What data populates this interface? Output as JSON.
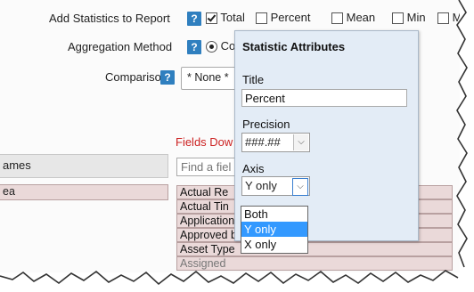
{
  "stats": {
    "label": "Add Statistics to Report",
    "options": [
      {
        "label": "Total",
        "checked": true
      },
      {
        "label": "Percent",
        "checked": false
      },
      {
        "label": "Mean",
        "checked": false
      },
      {
        "label": "Min",
        "checked": false
      },
      {
        "label": "Max",
        "checked": false
      }
    ]
  },
  "aggregation": {
    "label": "Aggregation Method",
    "option": "Count"
  },
  "comparison": {
    "label": "Comparison",
    "value": "* None *"
  },
  "help_glyph": "?",
  "left_pane": {
    "tab_label": "ames",
    "item_label": "ea"
  },
  "fields": {
    "heading": "Fields Dow",
    "search_placeholder": "Find a fiel",
    "items": [
      "Actual Re",
      "Actual Tin",
      "Application",
      "Approved b",
      "Asset Type",
      "Assigned"
    ]
  },
  "popup": {
    "title": "Statistic Attributes",
    "title_label": "Title",
    "title_value": "Percent",
    "precision_label": "Precision",
    "precision_value": "###.##",
    "axis_label": "Axis",
    "axis_value": "Y only",
    "axis_options": [
      "Both",
      "Y only",
      "X only"
    ],
    "axis_selected_index": 1
  },
  "colors": {
    "accent_blue": "#2f7fbf",
    "heading_red": "#cc2222",
    "highlight": "#3399ff",
    "row_bg": "#ead9d9"
  }
}
